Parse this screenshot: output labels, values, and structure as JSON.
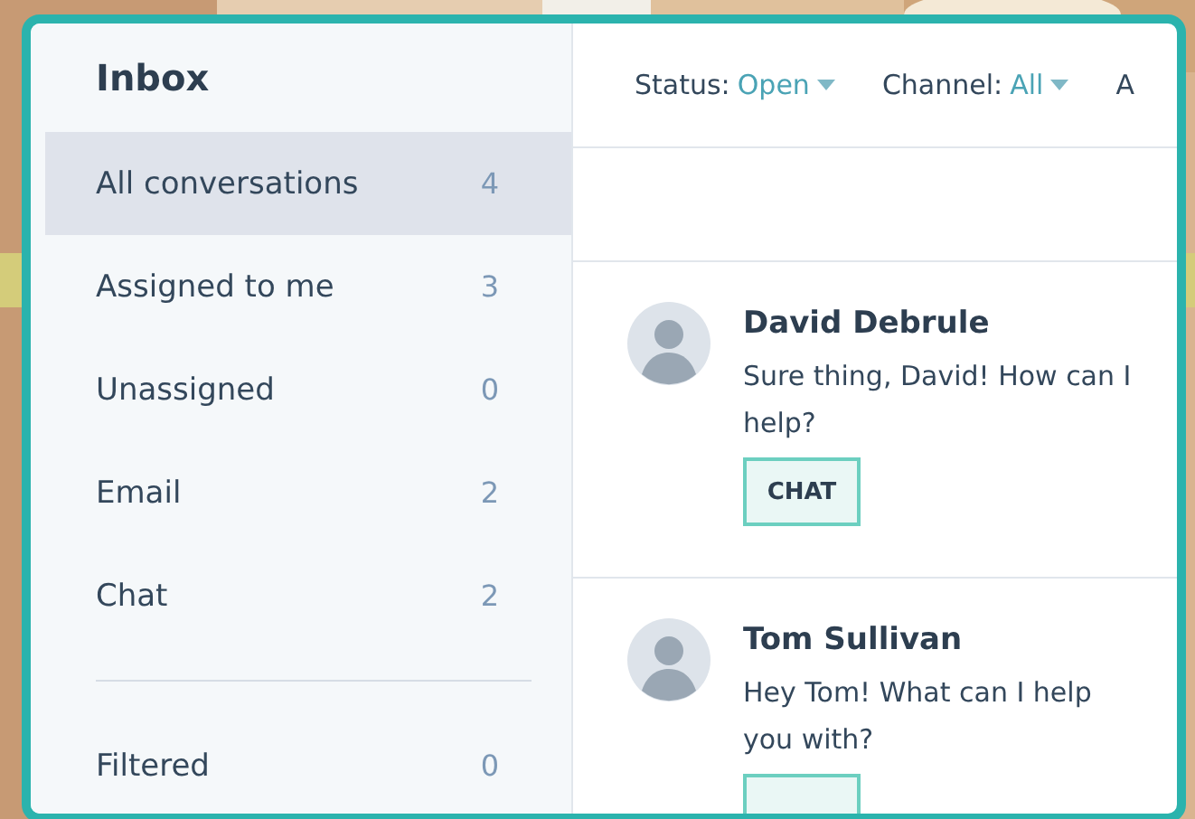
{
  "sidebar": {
    "title": "Inbox",
    "items": [
      {
        "label": "All conversations",
        "count": "4",
        "selected": true
      },
      {
        "label": "Assigned to me",
        "count": "3",
        "selected": false
      },
      {
        "label": "Unassigned",
        "count": "0",
        "selected": false
      },
      {
        "label": "Email",
        "count": "2",
        "selected": false
      },
      {
        "label": "Chat",
        "count": "2",
        "selected": false
      }
    ],
    "filtered_items": [
      {
        "label": "Filtered",
        "count": "0",
        "selected": false
      }
    ]
  },
  "filters": [
    {
      "label": "Status:",
      "value": "Open"
    },
    {
      "label": "Channel:",
      "value": "All"
    },
    {
      "label": "A"
    }
  ],
  "conversations": [
    {
      "name": "David Debrule",
      "message": "Sure thing, David! How can I help?",
      "tag": "CHAT"
    },
    {
      "name": "Tom Sullivan",
      "message": "Hey Tom! What can I help you with?"
    }
  ]
}
